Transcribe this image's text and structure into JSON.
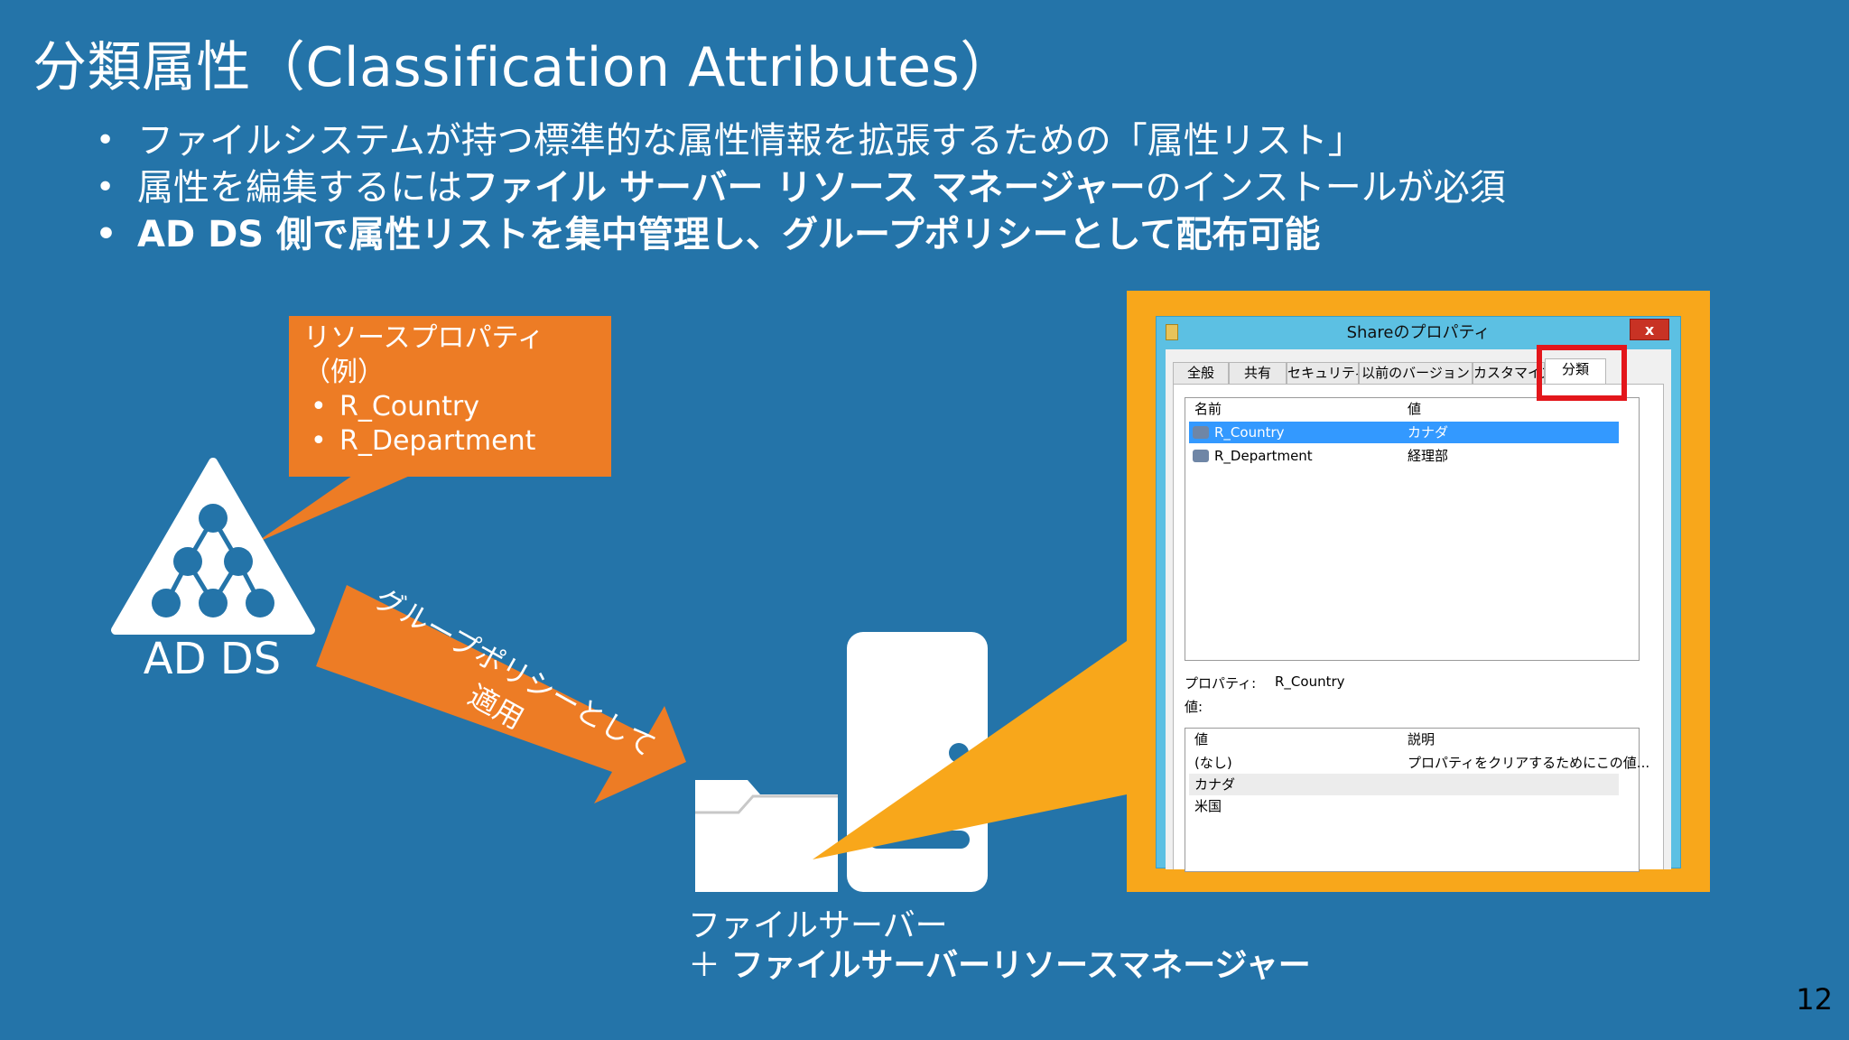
{
  "slide": {
    "title": "分類属性（Classification Attributes）",
    "bullets": [
      {
        "text": "ファイルシステムが持つ標準的な属性情報を拡張するための「属性リスト」"
      },
      {
        "pre": "属性を編集するには",
        "bold": "ファイル サーバー リソース マネージャー",
        "post": "のインストールが必須"
      },
      {
        "bold": "AD DS 側で属性リストを集中管理し、グループポリシーとして配布可能"
      }
    ],
    "callout": {
      "title_line1": "リソースプロパティ",
      "title_line2": "（例）",
      "items": [
        "R_Country",
        "R_Department"
      ]
    },
    "ad_label": "AD DS",
    "arrow_text": "グループポリシーとして\n適用",
    "arrow_line1": "グループポリシーとして",
    "arrow_line2": "適用",
    "fileserver_line1": "ファイルサーバー",
    "fileserver_line2_prefix": "＋ ",
    "fileserver_line2_bold": "ファイルサーバーリソースマネージャー",
    "page_number": "12",
    "colors": {
      "background": "#2474a9",
      "orange": "#ed7c25",
      "frame": "#f8a71b",
      "highlight": "#e3161b"
    }
  },
  "dialog": {
    "title": "Shareのプロパティ",
    "close": "x",
    "tabs": [
      "全般",
      "共有",
      "セキュリティ",
      "以前のバージョン",
      "カスタマイズ",
      "分類"
    ],
    "active_tab": "分類",
    "list_headers": [
      "名前",
      "値"
    ],
    "rows": [
      {
        "name": "R_Country",
        "value": "カナダ",
        "selected": true
      },
      {
        "name": "R_Department",
        "value": "経理部",
        "selected": false
      }
    ],
    "property_label": "プロパティ:",
    "property_value": "R_Country",
    "value_label": "値:",
    "value_headers": [
      "値",
      "説明"
    ],
    "value_rows": [
      {
        "value": "(なし)",
        "desc": "プロパティをクリアするためにこの値..."
      },
      {
        "value": "カナダ",
        "desc": ""
      },
      {
        "value": "米国",
        "desc": ""
      }
    ]
  }
}
